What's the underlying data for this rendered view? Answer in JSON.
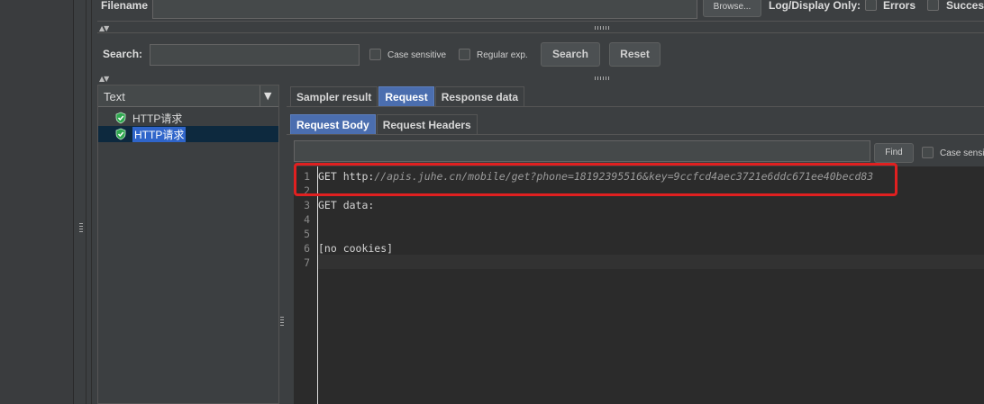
{
  "file_panel": {
    "filename_label": "Filename",
    "browse_label": "Browse...",
    "log_display_label": "Log/Display Only:",
    "errors_label": "Errors",
    "successes_label": "Succes"
  },
  "search_bar": {
    "search_label": "Search:",
    "search_value": "",
    "case_sensitive_label": "Case sensitive",
    "regex_label": "Regular exp.",
    "search_button": "Search",
    "reset_button": "Reset"
  },
  "tree": {
    "renderer_selected": "Text",
    "items": [
      {
        "label": "HTTP请求",
        "status": "success",
        "selected": false
      },
      {
        "label": "HTTP请求",
        "status": "success",
        "selected": true
      }
    ]
  },
  "result_tabs": [
    {
      "label": "Sampler result",
      "active": false
    },
    {
      "label": "Request",
      "active": true
    },
    {
      "label": "Response data",
      "active": false
    }
  ],
  "request_subtabs": [
    {
      "label": "Request Body",
      "active": true
    },
    {
      "label": "Request Headers",
      "active": false
    }
  ],
  "find_bar": {
    "find_value": "",
    "find_button": "Find",
    "case_sensitive_label": "Case sensi"
  },
  "editor": {
    "lines": [
      {
        "num": "1",
        "prefix": "GET http:",
        "url": "//apis.juhe.cn/mobile/get?phone=18192395516&key=9ccfcd4aec3721e6ddc671ee40becd83"
      },
      {
        "num": "2",
        "prefix": "",
        "url": ""
      },
      {
        "num": "3",
        "prefix": "GET data:",
        "url": ""
      },
      {
        "num": "4",
        "prefix": "",
        "url": ""
      },
      {
        "num": "5",
        "prefix": "",
        "url": ""
      },
      {
        "num": "6",
        "prefix": "[no cookies]",
        "url": ""
      },
      {
        "num": "7",
        "prefix": "",
        "url": ""
      }
    ]
  },
  "colors": {
    "background": "#3c3f41",
    "editor_background": "#2b2b2b",
    "selection": "#2f65ca",
    "active_tab": "#4b6eaf",
    "highlight_box": "#e02020",
    "success_icon": "#2fa84f"
  }
}
